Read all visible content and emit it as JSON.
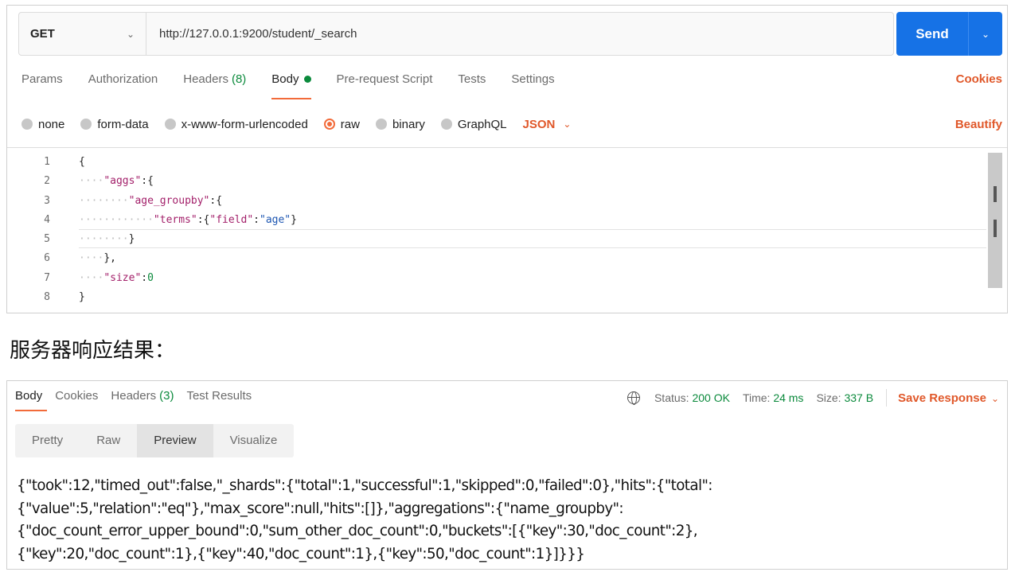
{
  "request": {
    "method": "GET",
    "url": "http://127.0.0.1:9200/student/_search",
    "send_label": "Send",
    "tabs": [
      {
        "label": "Params"
      },
      {
        "label": "Authorization"
      },
      {
        "label": "Headers",
        "count": "(8)"
      },
      {
        "label": "Body"
      },
      {
        "label": "Pre-request Script"
      },
      {
        "label": "Tests"
      },
      {
        "label": "Settings"
      }
    ],
    "cookies_label": "Cookies",
    "body_types": [
      "none",
      "form-data",
      "x-www-form-urlencoded",
      "raw",
      "binary",
      "GraphQL"
    ],
    "selected_body_type": "raw",
    "format": "JSON",
    "beautify_label": "Beautify",
    "line_numbers": [
      "1",
      "2",
      "3",
      "4",
      "5",
      "6",
      "7",
      "8"
    ],
    "code_lines": [
      "{",
      "    \"aggs\":{",
      "        \"age_groupby\":{",
      "            \"terms\":{\"field\":\"age\"}",
      "        }",
      "    },",
      "    \"size\":0",
      "}"
    ]
  },
  "caption": "服务器响应结果：",
  "response": {
    "tabs": [
      {
        "label": "Body"
      },
      {
        "label": "Cookies"
      },
      {
        "label": "Headers",
        "count": "(3)"
      },
      {
        "label": "Test Results"
      }
    ],
    "status_label": "Status:",
    "status_value": "200 OK",
    "time_label": "Time:",
    "time_value": "24 ms",
    "size_label": "Size:",
    "size_value": "337 B",
    "save_label": "Save Response",
    "view_tabs": [
      "Pretty",
      "Raw",
      "Preview",
      "Visualize"
    ],
    "active_view": "Preview",
    "body_lines": [
      "{\"took\":12,\"timed_out\":false,\"_shards\":{\"total\":1,\"successful\":1,\"skipped\":0,\"failed\":0},\"hits\":{\"total\":",
      "{\"value\":5,\"relation\":\"eq\"},\"max_score\":null,\"hits\":[]},\"aggregations\":{\"name_groupby\":",
      "{\"doc_count_error_upper_bound\":0,\"sum_other_doc_count\":0,\"buckets\":[{\"key\":30,\"doc_count\":2},",
      "{\"key\":20,\"doc_count\":1},{\"key\":40,\"doc_count\":1},{\"key\":50,\"doc_count\":1}]}}}"
    ]
  },
  "colors": {
    "accent_orange": "#f26b3a",
    "send_blue": "#1672e6",
    "status_green": "#0b8a3c"
  }
}
